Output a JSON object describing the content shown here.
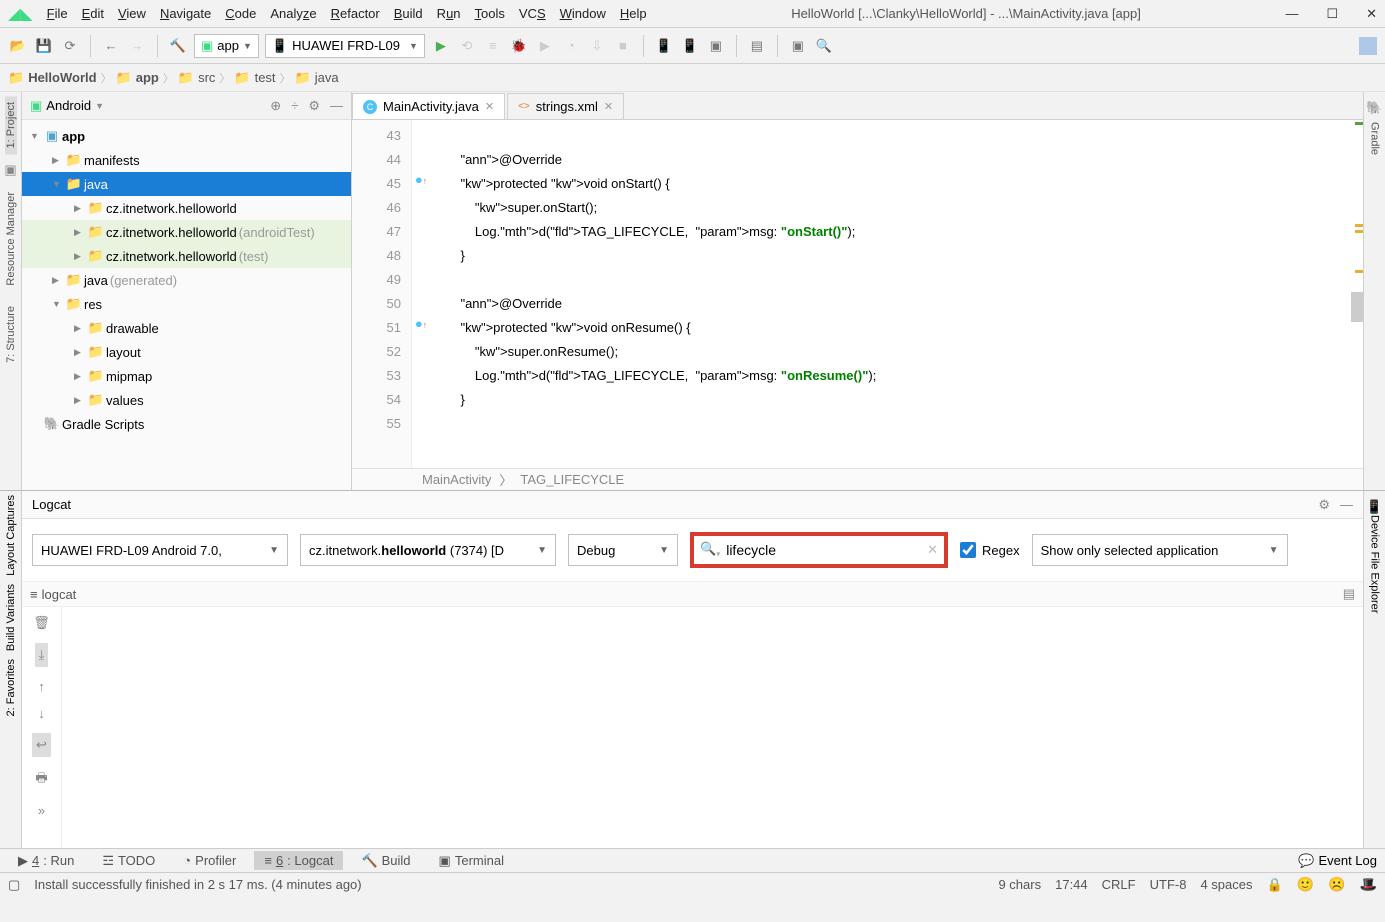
{
  "menu": {
    "items": [
      "File",
      "Edit",
      "View",
      "Navigate",
      "Code",
      "Analyze",
      "Refactor",
      "Build",
      "Run",
      "Tools",
      "VCS",
      "Window",
      "Help"
    ],
    "title": "HelloWorld [...\\Clanky\\HelloWorld] - ...\\MainActivity.java [app]"
  },
  "toolbar": {
    "config": "app",
    "device": "HUAWEI FRD-L09"
  },
  "breadcrumb": [
    "HelloWorld",
    "app",
    "src",
    "test",
    "java"
  ],
  "left_tools": [
    "1: Project",
    "Resource Manager",
    "7: Structure",
    "Build Variants",
    "Layout Captures",
    "2: Favorites"
  ],
  "right_tools": [
    "Gradle",
    "Device File Explorer"
  ],
  "project": {
    "mode": "Android",
    "tree": [
      {
        "indent": 0,
        "caret": "▼",
        "icon": "module",
        "label": "app",
        "bold": true
      },
      {
        "indent": 1,
        "caret": "▶",
        "icon": "folder",
        "label": "manifests"
      },
      {
        "indent": 1,
        "caret": "▼",
        "icon": "folder",
        "label": "java",
        "selected": true
      },
      {
        "indent": 2,
        "caret": "▶",
        "icon": "pkg",
        "label": "cz.itnetwork.helloworld"
      },
      {
        "indent": 2,
        "caret": "▶",
        "icon": "pkg",
        "label": "cz.itnetwork.helloworld",
        "suffix": " (androidTest)",
        "hl": true
      },
      {
        "indent": 2,
        "caret": "▶",
        "icon": "pkg",
        "label": "cz.itnetwork.helloworld",
        "suffix": " (test)",
        "hl": true
      },
      {
        "indent": 1,
        "caret": "▶",
        "icon": "genfolder",
        "label": "java",
        "suffix": " (generated)"
      },
      {
        "indent": 1,
        "caret": "▼",
        "icon": "resfolder",
        "label": "res"
      },
      {
        "indent": 2,
        "caret": "▶",
        "icon": "resfolder",
        "label": "drawable"
      },
      {
        "indent": 2,
        "caret": "▶",
        "icon": "resfolder",
        "label": "layout"
      },
      {
        "indent": 2,
        "caret": "▶",
        "icon": "resfolder",
        "label": "mipmap"
      },
      {
        "indent": 2,
        "caret": "▶",
        "icon": "resfolder",
        "label": "values"
      },
      {
        "indent": 0,
        "caret": "",
        "icon": "gradle",
        "label": "Gradle Scripts"
      }
    ]
  },
  "tabs": [
    {
      "icon": "class",
      "label": "MainActivity.java",
      "active": true
    },
    {
      "icon": "xml",
      "label": "strings.xml",
      "active": false
    }
  ],
  "code": {
    "start": 43,
    "lines": [
      "",
      "    @Override",
      "    protected void onStart() {",
      "        super.onStart();",
      "        Log.d(TAG_LIFECYCLE,  msg: \"onStart()\");",
      "    }",
      "",
      "    @Override",
      "    protected void onResume() {",
      "        super.onResume();",
      "        Log.d(TAG_LIFECYCLE,  msg: \"onResume()\");",
      "    }",
      ""
    ],
    "marks": {
      "45": "●↑",
      "51": "●↑"
    },
    "crumbs": [
      "MainActivity",
      "TAG_LIFECYCLE"
    ]
  },
  "logcat": {
    "title": "Logcat",
    "device": "HUAWEI FRD-L09 Android 7.0,",
    "process_prefix": "cz.itnetwork.",
    "process_bold": "helloworld",
    "process_suffix": " (7374) [D",
    "level": "Debug",
    "search": "lifecycle",
    "regex_label": "Regex",
    "filter": "Show only selected application",
    "tab": "logcat"
  },
  "bottom_tabs": [
    {
      "icon": "▶",
      "label": "4: Run"
    },
    {
      "icon": "☰",
      "label": "TODO"
    },
    {
      "icon": "◔",
      "label": "Profiler"
    },
    {
      "icon": "≡",
      "label": "6: Logcat",
      "active": true
    },
    {
      "icon": "🔨",
      "label": "Build"
    },
    {
      "icon": "▣",
      "label": "Terminal"
    }
  ],
  "event_log": "Event Log",
  "status": {
    "msg": "Install successfully finished in 2 s 17 ms. (4 minutes ago)",
    "chars": "9 chars",
    "time": "17:44",
    "eol": "CRLF",
    "enc": "UTF-8",
    "indent": "4 spaces"
  }
}
